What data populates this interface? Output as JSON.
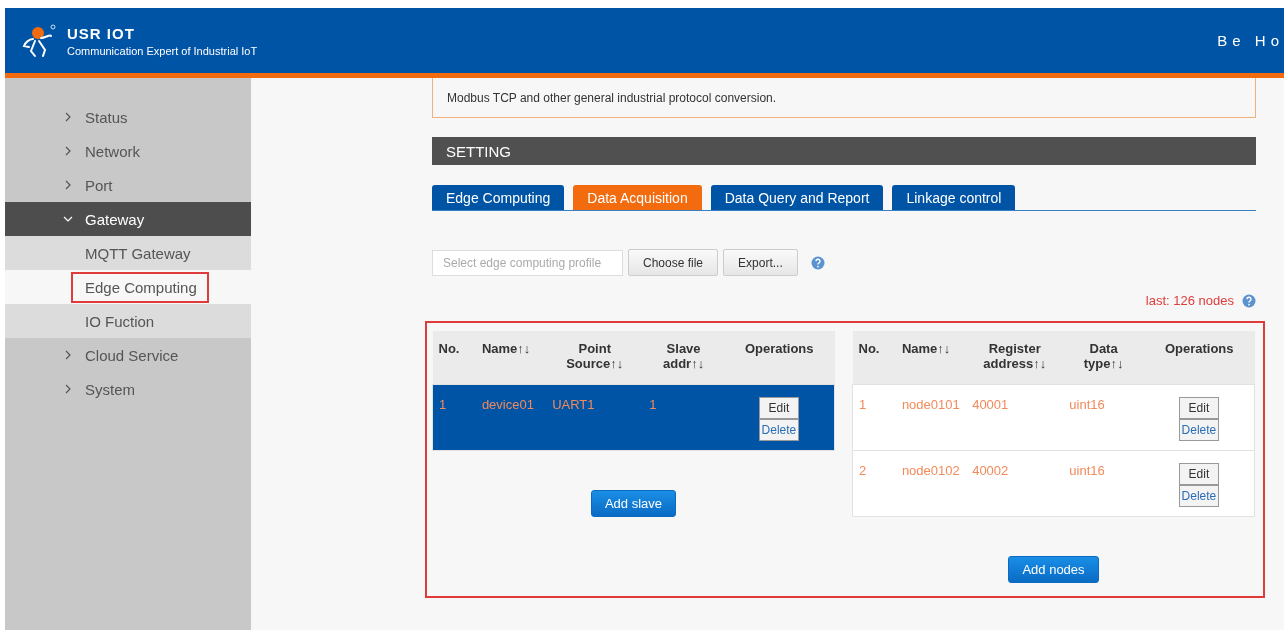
{
  "header": {
    "brand": "USR IOT",
    "tagline": "Communication Expert of Industrial IoT",
    "right_text": "Be Ho"
  },
  "sidebar": {
    "items": [
      {
        "label": "Status",
        "kind": "group",
        "expanded": false,
        "selected": false,
        "highlighted": false
      },
      {
        "label": "Network",
        "kind": "group",
        "expanded": false,
        "selected": false,
        "highlighted": false
      },
      {
        "label": "Port",
        "kind": "group",
        "expanded": false,
        "selected": false,
        "highlighted": false
      },
      {
        "label": "Gateway",
        "kind": "group",
        "expanded": true,
        "selected": false,
        "highlighted": false
      },
      {
        "label": "MQTT Gateway",
        "kind": "sub",
        "expanded": false,
        "selected": false,
        "highlighted": false
      },
      {
        "label": "Edge Computing",
        "kind": "sub",
        "expanded": false,
        "selected": true,
        "highlighted": true
      },
      {
        "label": "IO Fuction",
        "kind": "sub",
        "expanded": false,
        "selected": false,
        "highlighted": false
      },
      {
        "label": "Cloud Service",
        "kind": "group",
        "expanded": false,
        "selected": false,
        "highlighted": false
      },
      {
        "label": "System",
        "kind": "group",
        "expanded": false,
        "selected": false,
        "highlighted": false
      }
    ]
  },
  "notice": {
    "text": "Modbus TCP and other general industrial protocol conversion."
  },
  "section_title": "SETTING",
  "tabs": [
    {
      "label": "Edge Computing",
      "selected": false
    },
    {
      "label": "Data Acquisition",
      "selected": true
    },
    {
      "label": "Data Query and Report",
      "selected": false
    },
    {
      "label": "Linkage control",
      "selected": false
    }
  ],
  "toolbar": {
    "placeholder": "Select edge computing profile",
    "buttons": [
      "Choose file",
      "Export..."
    ]
  },
  "node_count": "last: 126 nodes",
  "tables_highlighted": true,
  "slave_table": {
    "columns": [
      "No.",
      "Name↑↓",
      "Point Source↑↓",
      "Slave addr↑↓",
      "Operations"
    ],
    "rows": [
      {
        "cells": [
          "1",
          "device01",
          "UART1",
          "1"
        ],
        "actions": [
          "Edit",
          "Delete"
        ],
        "selected": true
      }
    ],
    "add_button": "Add slave"
  },
  "node_table": {
    "columns": [
      "No.",
      "Name↑↓",
      "Register address↑↓",
      "Data type↑↓",
      "Operations"
    ],
    "rows": [
      {
        "cells": [
          "1",
          "node0101",
          "40001",
          "uint16"
        ],
        "actions": [
          "Edit",
          "Delete"
        ],
        "selected": false
      },
      {
        "cells": [
          "2",
          "node0102",
          "40002",
          "uint16"
        ],
        "actions": [
          "Edit",
          "Delete"
        ],
        "selected": false
      }
    ],
    "add_button": "Add nodes"
  }
}
